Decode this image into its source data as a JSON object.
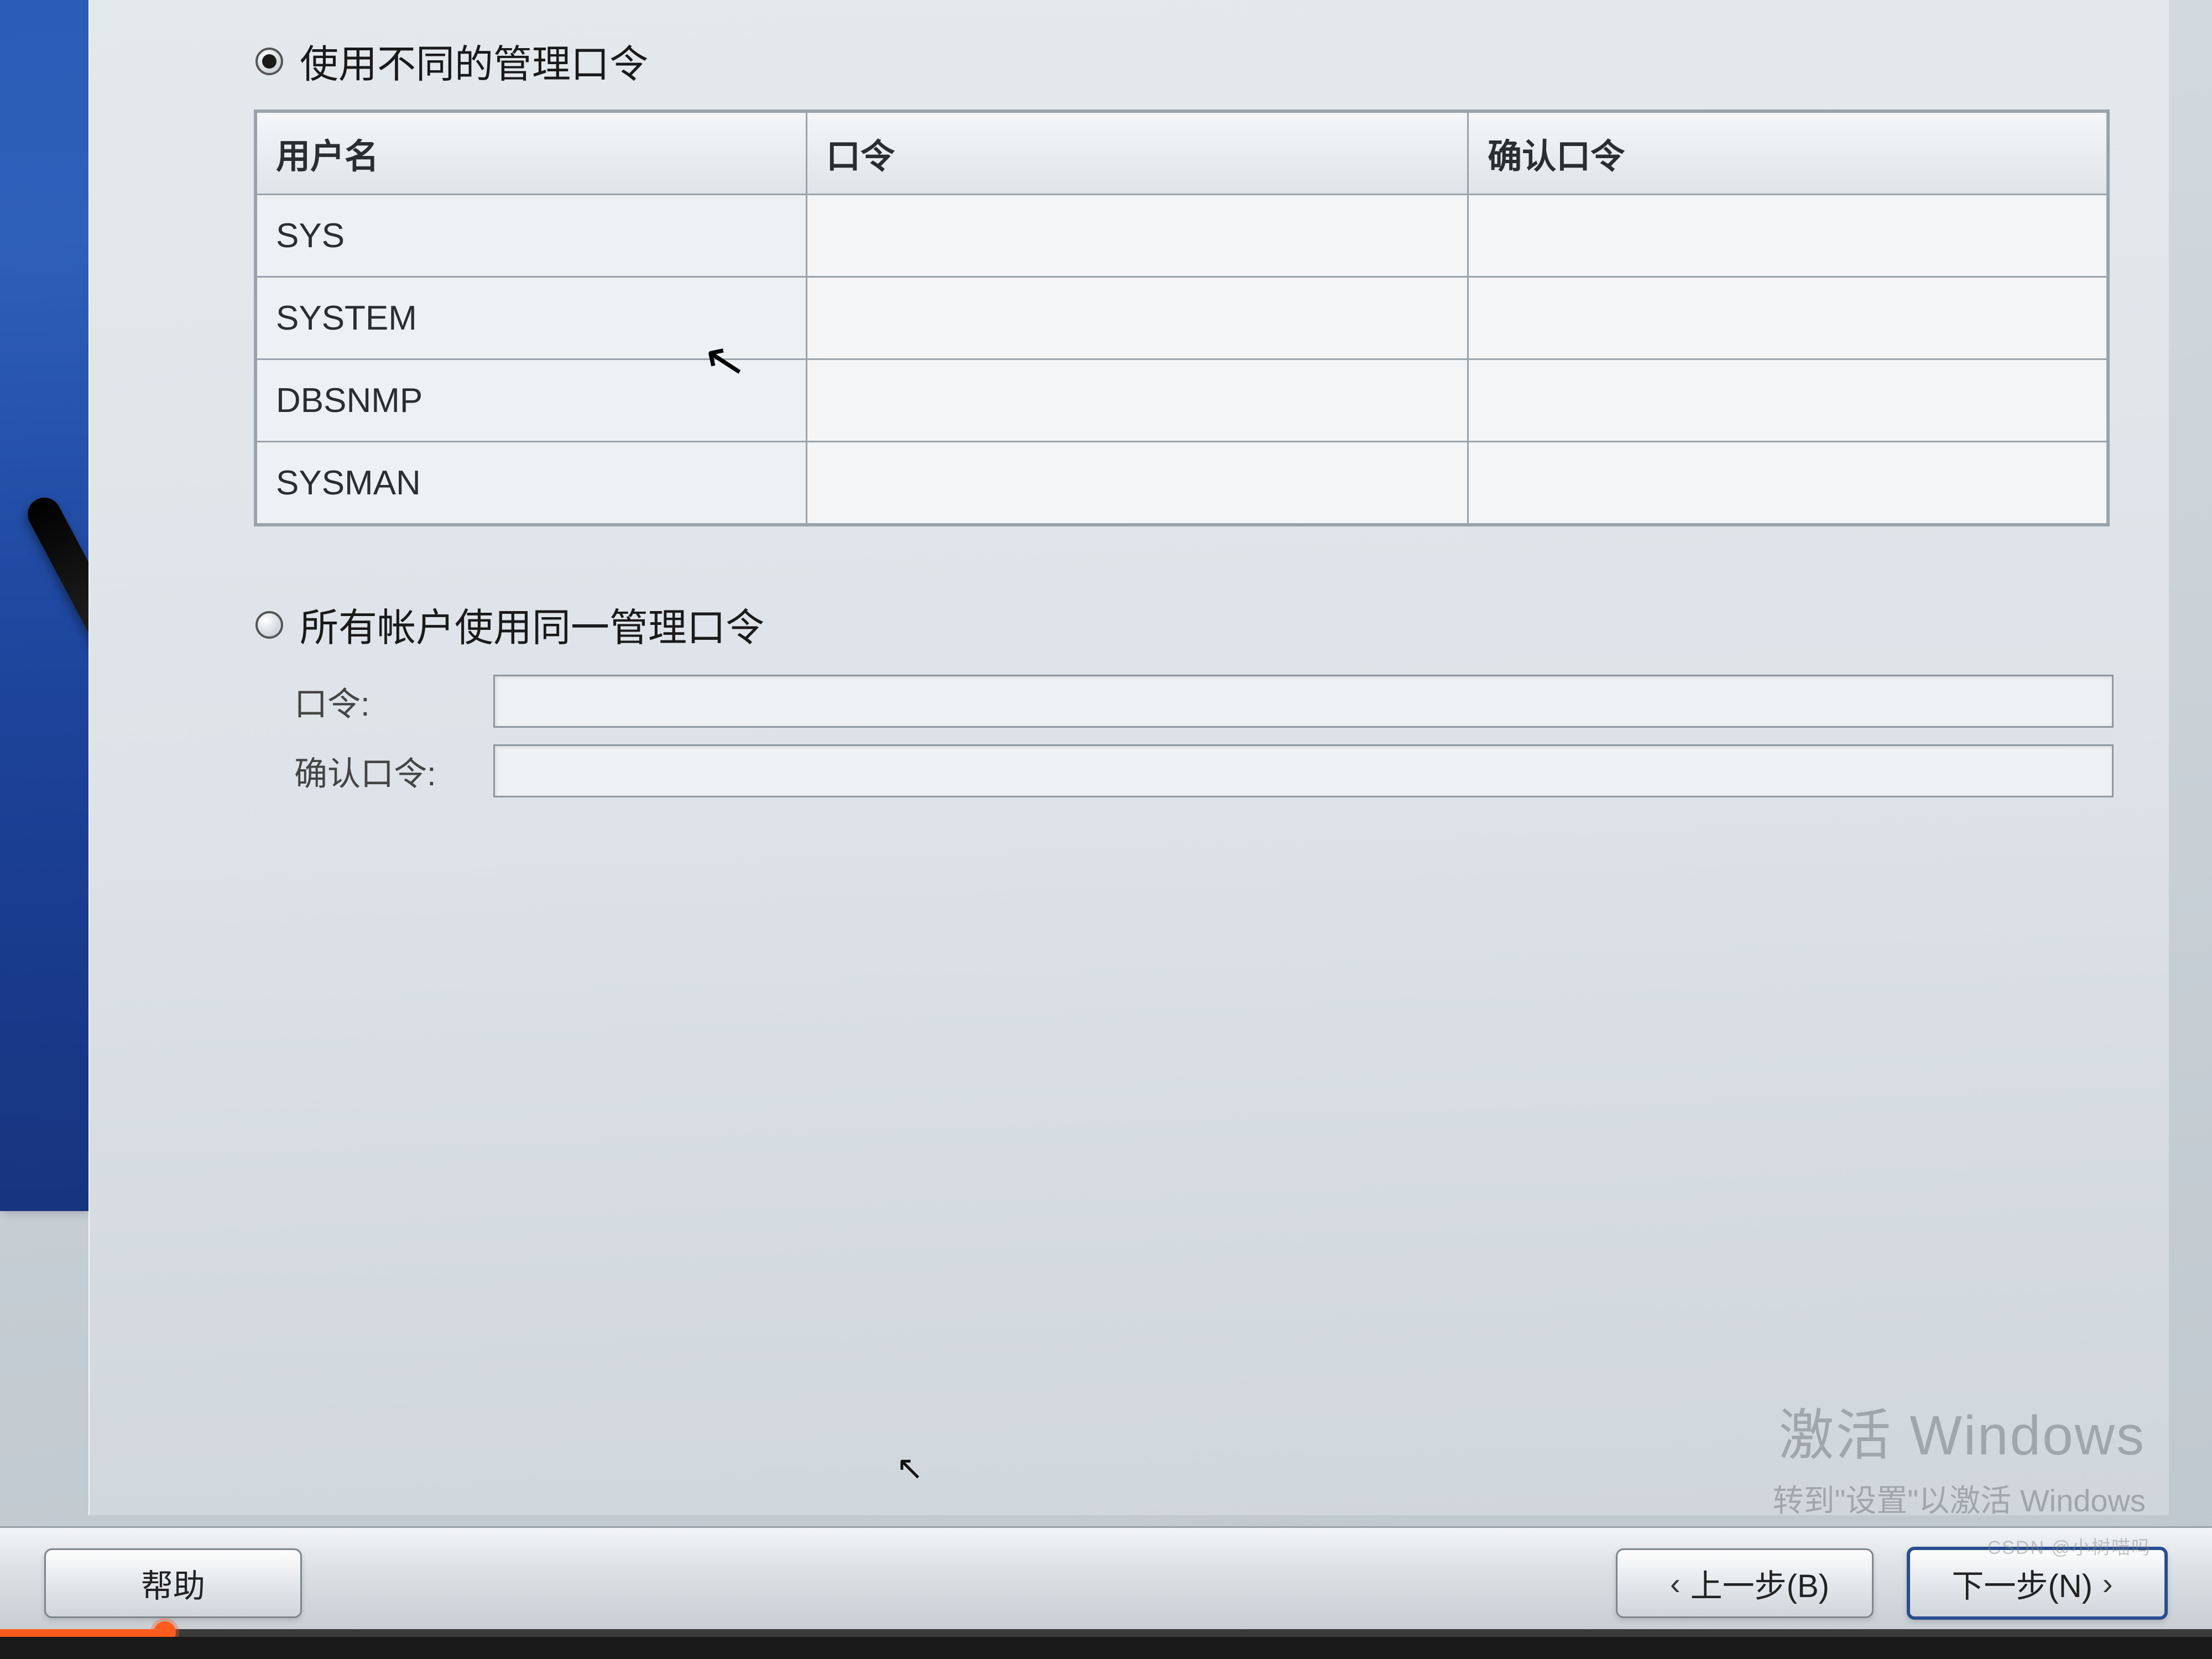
{
  "option1": {
    "label": "使用不同的管理口令",
    "selected": true
  },
  "table": {
    "headers": {
      "user": "用户名",
      "password": "口令",
      "confirm": "确认口令"
    },
    "rows": [
      {
        "user": "SYS",
        "password": "",
        "confirm": ""
      },
      {
        "user": "SYSTEM",
        "password": "",
        "confirm": ""
      },
      {
        "user": "DBSNMP",
        "password": "",
        "confirm": ""
      },
      {
        "user": "SYSMAN",
        "password": "",
        "confirm": ""
      }
    ]
  },
  "option2": {
    "label": "所有帐户使用同一管理口令",
    "selected": false,
    "password_label": "口令:",
    "confirm_label": "确认口令:",
    "password_value": "",
    "confirm_value": ""
  },
  "buttons": {
    "help": "帮助",
    "back": "上一步(B)",
    "next": "下一步(N)",
    "back_arrow": "‹",
    "next_arrow": "›"
  },
  "watermark": {
    "line1": "激活 Windows",
    "line2": "转到\"设置\"以激活 Windows"
  },
  "csdn": "CSDN @小树喵吗"
}
